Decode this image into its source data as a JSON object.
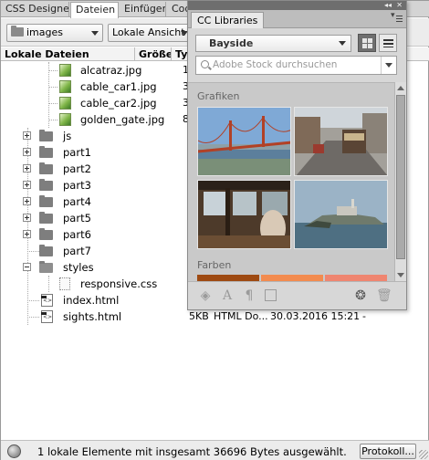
{
  "tabs": [
    {
      "label": "CSS Designer",
      "active": false
    },
    {
      "label": "Dateien",
      "active": true
    },
    {
      "label": "Einfügen",
      "active": false
    },
    {
      "label": "Code",
      "active": false
    }
  ],
  "toolbar": {
    "site_select": "images",
    "view_select": "Lokale Ansicht"
  },
  "columns": {
    "name": "Lokale Dateien",
    "size": "Größe",
    "type": "Typ"
  },
  "files": [
    {
      "name": "alcatraz.jpg",
      "size": "1",
      "kind": "image"
    },
    {
      "name": "cable_car1.jpg",
      "size": "3",
      "kind": "image"
    },
    {
      "name": "cable_car2.jpg",
      "size": "3",
      "kind": "image"
    },
    {
      "name": "golden_gate.jpg",
      "size": "8",
      "kind": "image"
    },
    {
      "name": "js",
      "kind": "folder"
    },
    {
      "name": "part1",
      "kind": "folder"
    },
    {
      "name": "part2",
      "kind": "folder"
    },
    {
      "name": "part3",
      "kind": "folder"
    },
    {
      "name": "part4",
      "kind": "folder"
    },
    {
      "name": "part5",
      "kind": "folder"
    },
    {
      "name": "part6",
      "kind": "folder"
    },
    {
      "name": "part7",
      "kind": "folder"
    },
    {
      "name": "styles",
      "kind": "folder"
    },
    {
      "name": "responsive.css",
      "kind": "css"
    },
    {
      "name": "index.html",
      "kind": "html"
    },
    {
      "name": "sights.html",
      "kind": "html",
      "size": "5KB",
      "type": "HTML Do...",
      "modified": "30.03.2016 15:21",
      "checked_out": "-"
    }
  ],
  "status": {
    "message": "1 lokale Elemente mit insgesamt 36696 Bytes ausgewählt.",
    "log_button": "Protokoll..."
  },
  "cc_libraries": {
    "tab_label": "CC Libraries",
    "library_select": "Bayside",
    "search_placeholder": "Adobe Stock durchsuchen",
    "section_graphics": "Grafiken",
    "section_colors": "Farben",
    "swatches": [
      "#9e4a12",
      "#f28b4f",
      "#ef8570"
    ]
  }
}
